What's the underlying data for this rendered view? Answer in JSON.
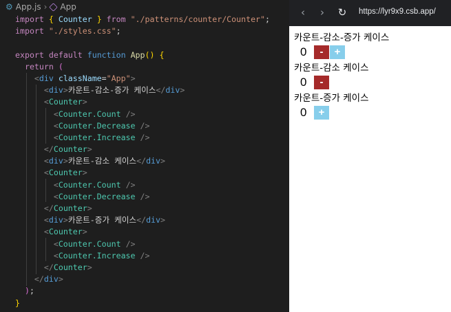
{
  "editor": {
    "breadcrumb": {
      "file": "App.js",
      "symbol": "App"
    },
    "lines": [
      [
        [
          "kw",
          "import"
        ],
        [
          "punc",
          " "
        ],
        [
          "br",
          "{"
        ],
        [
          "punc",
          " "
        ],
        [
          "id",
          "Counter"
        ],
        [
          "punc",
          " "
        ],
        [
          "br",
          "}"
        ],
        [
          "punc",
          " "
        ],
        [
          "kw",
          "from"
        ],
        [
          "punc",
          " "
        ],
        [
          "str",
          "\"./patterns/counter/Counter\""
        ],
        [
          "punc",
          ";"
        ]
      ],
      [
        [
          "kw",
          "import"
        ],
        [
          "punc",
          " "
        ],
        [
          "str",
          "\"./styles.css\""
        ],
        [
          "punc",
          ";"
        ]
      ],
      [],
      [
        [
          "kw",
          "export"
        ],
        [
          "punc",
          " "
        ],
        [
          "kw",
          "default"
        ],
        [
          "punc",
          " "
        ],
        [
          "kw2",
          "function"
        ],
        [
          "punc",
          " "
        ],
        [
          "fn",
          "App"
        ],
        [
          "br",
          "()"
        ],
        [
          "punc",
          " "
        ],
        [
          "br",
          "{"
        ]
      ],
      [
        [
          "punc",
          "  "
        ],
        [
          "kw",
          "return"
        ],
        [
          "punc",
          " "
        ],
        [
          "br2",
          "("
        ]
      ],
      [
        [
          "punc",
          "    "
        ],
        [
          "ang",
          "<"
        ],
        [
          "tag",
          "div"
        ],
        [
          "punc",
          " "
        ],
        [
          "attr",
          "className"
        ],
        [
          "punc",
          "="
        ],
        [
          "str",
          "\"App\""
        ],
        [
          "ang",
          ">"
        ]
      ],
      [
        [
          "punc",
          "      "
        ],
        [
          "ang",
          "<"
        ],
        [
          "tag",
          "div"
        ],
        [
          "ang",
          ">"
        ],
        [
          "txt",
          "카운트-감소-증가 케이스"
        ],
        [
          "ang",
          "</"
        ],
        [
          "tag",
          "div"
        ],
        [
          "ang",
          ">"
        ]
      ],
      [
        [
          "punc",
          "      "
        ],
        [
          "ang",
          "<"
        ],
        [
          "ctag",
          "Counter"
        ],
        [
          "ang",
          ">"
        ]
      ],
      [
        [
          "punc",
          "        "
        ],
        [
          "ang",
          "<"
        ],
        [
          "ctag",
          "Counter.Count"
        ],
        [
          "punc",
          " "
        ],
        [
          "ang",
          "/>"
        ]
      ],
      [
        [
          "punc",
          "        "
        ],
        [
          "ang",
          "<"
        ],
        [
          "ctag",
          "Counter.Decrease"
        ],
        [
          "punc",
          " "
        ],
        [
          "ang",
          "/>"
        ]
      ],
      [
        [
          "punc",
          "        "
        ],
        [
          "ang",
          "<"
        ],
        [
          "ctag",
          "Counter.Increase"
        ],
        [
          "punc",
          " "
        ],
        [
          "ang",
          "/>"
        ]
      ],
      [
        [
          "punc",
          "      "
        ],
        [
          "ang",
          "</"
        ],
        [
          "ctag",
          "Counter"
        ],
        [
          "ang",
          ">"
        ]
      ],
      [
        [
          "punc",
          "      "
        ],
        [
          "ang",
          "<"
        ],
        [
          "tag",
          "div"
        ],
        [
          "ang",
          ">"
        ],
        [
          "txt",
          "카운트-감소 케이스"
        ],
        [
          "ang",
          "</"
        ],
        [
          "tag",
          "div"
        ],
        [
          "ang",
          ">"
        ]
      ],
      [
        [
          "punc",
          "      "
        ],
        [
          "ang",
          "<"
        ],
        [
          "ctag",
          "Counter"
        ],
        [
          "ang",
          ">"
        ]
      ],
      [
        [
          "punc",
          "        "
        ],
        [
          "ang",
          "<"
        ],
        [
          "ctag",
          "Counter.Count"
        ],
        [
          "punc",
          " "
        ],
        [
          "ang",
          "/>"
        ]
      ],
      [
        [
          "punc",
          "        "
        ],
        [
          "ang",
          "<"
        ],
        [
          "ctag",
          "Counter.Decrease"
        ],
        [
          "punc",
          " "
        ],
        [
          "ang",
          "/>"
        ]
      ],
      [
        [
          "punc",
          "      "
        ],
        [
          "ang",
          "</"
        ],
        [
          "ctag",
          "Counter"
        ],
        [
          "ang",
          ">"
        ]
      ],
      [
        [
          "punc",
          "      "
        ],
        [
          "ang",
          "<"
        ],
        [
          "tag",
          "div"
        ],
        [
          "ang",
          ">"
        ],
        [
          "txt",
          "카운트-증가 케이스"
        ],
        [
          "ang",
          "</"
        ],
        [
          "tag",
          "div"
        ],
        [
          "ang",
          ">"
        ]
      ],
      [
        [
          "punc",
          "      "
        ],
        [
          "ang",
          "<"
        ],
        [
          "ctag",
          "Counter"
        ],
        [
          "ang",
          ">"
        ]
      ],
      [
        [
          "punc",
          "        "
        ],
        [
          "ang",
          "<"
        ],
        [
          "ctag",
          "Counter.Count"
        ],
        [
          "punc",
          " "
        ],
        [
          "ang",
          "/>"
        ]
      ],
      [
        [
          "punc",
          "        "
        ],
        [
          "ang",
          "<"
        ],
        [
          "ctag",
          "Counter.Increase"
        ],
        [
          "punc",
          " "
        ],
        [
          "ang",
          "/>"
        ]
      ],
      [
        [
          "punc",
          "      "
        ],
        [
          "ang",
          "</"
        ],
        [
          "ctag",
          "Counter"
        ],
        [
          "ang",
          ">"
        ]
      ],
      [
        [
          "punc",
          "    "
        ],
        [
          "ang",
          "</"
        ],
        [
          "tag",
          "div"
        ],
        [
          "ang",
          ">"
        ]
      ],
      [
        [
          "punc",
          "  "
        ],
        [
          "br2",
          ")"
        ],
        [
          "punc",
          ";"
        ]
      ],
      [
        [
          "br",
          "}"
        ]
      ]
    ]
  },
  "browser": {
    "url": "https://lyr9x9.csb.app/",
    "icons": {
      "back": "chevron-left-icon",
      "forward": "chevron-right-icon",
      "reload": "reload-icon"
    }
  },
  "app": {
    "colors": {
      "decrease": "#a52a2a",
      "increase": "#87ceeb"
    },
    "cases": [
      {
        "title": "카운트-감소-증가 케이스",
        "count": "0",
        "decrease": "-",
        "increase": "+"
      },
      {
        "title": "카운트-감소 케이스",
        "count": "0",
        "decrease": "-"
      },
      {
        "title": "카운트-증가 케이스",
        "count": "0",
        "increase": "+"
      }
    ]
  }
}
